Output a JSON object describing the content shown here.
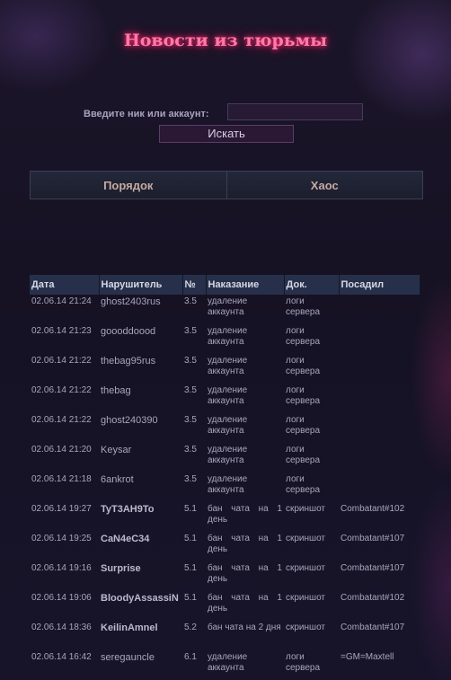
{
  "page": {
    "title": "Новости из тюрьмы"
  },
  "search": {
    "label": "Введите ник или аккаунт:",
    "value": "",
    "button_label": "Искать"
  },
  "tabs": [
    "Порядок",
    "Хаос"
  ],
  "table": {
    "headers": [
      "Дата",
      "Нарушитель",
      "№",
      "Наказание",
      "Док.",
      "Посадил"
    ],
    "rows": [
      {
        "date": "02.06.14 21:24",
        "offender": "ghost2403rus",
        "bold": false,
        "rule": "3.5",
        "punishment": "удаление аккаунта",
        "doc": "логи сервера",
        "jailer": ""
      },
      {
        "date": "02.06.14 21:23",
        "offender": "goooddoood",
        "bold": false,
        "rule": "3.5",
        "punishment": "удаление аккаунта",
        "doc": "логи сервера",
        "jailer": ""
      },
      {
        "date": "02.06.14 21:22",
        "offender": "thebag95rus",
        "bold": false,
        "rule": "3.5",
        "punishment": "удаление аккаунта",
        "doc": "логи сервера",
        "jailer": ""
      },
      {
        "date": "02.06.14 21:22",
        "offender": "thebag",
        "bold": false,
        "rule": "3.5",
        "punishment": "удаление аккаунта",
        "doc": "логи сервера",
        "jailer": ""
      },
      {
        "date": "02.06.14 21:22",
        "offender": "ghost240390",
        "bold": false,
        "rule": "3.5",
        "punishment": "удаление аккаунта",
        "doc": "логи сервера",
        "jailer": ""
      },
      {
        "date": "02.06.14 21:20",
        "offender": "Keysar",
        "bold": false,
        "rule": "3.5",
        "punishment": "удаление аккаунта",
        "doc": "логи сервера",
        "jailer": ""
      },
      {
        "date": "02.06.14 21:18",
        "offender": "6ankrot",
        "bold": false,
        "rule": "3.5",
        "punishment": "удаление аккаунта",
        "doc": "логи сервера",
        "jailer": ""
      },
      {
        "date": "02.06.14 19:27",
        "offender": "TyT3AH9To",
        "bold": true,
        "rule": "5.1",
        "punishment": "бан чата на 1 день",
        "doc": "скриншот",
        "jailer": "Combatant#102"
      },
      {
        "date": "02.06.14 19:25",
        "offender": "CaN4eC34",
        "bold": true,
        "rule": "5.1",
        "punishment": "бан чата на 1 день",
        "doc": "скриншот",
        "jailer": "Combatant#107"
      },
      {
        "date": "02.06.14 19:16",
        "offender": "Surprise",
        "bold": true,
        "rule": "5.1",
        "punishment": "бан чата на 1 день",
        "doc": "скриншот",
        "jailer": "Combatant#107"
      },
      {
        "date": "02.06.14 19:06",
        "offender": "BloodyAssassiN",
        "bold": true,
        "rule": "5.1",
        "punishment": "бан чата на 1 день",
        "doc": "скриншот",
        "jailer": "Combatant#102"
      },
      {
        "date": "02.06.14 18:36",
        "offender": "KeilinAmnel",
        "bold": true,
        "rule": "5.2",
        "punishment": "бан чата на 2 дня",
        "doc": "скриншот",
        "jailer": "Combatant#107"
      },
      {
        "date": "02.06.14 16:42",
        "offender": "seregauncle",
        "bold": false,
        "rule": "6.1",
        "punishment": "удаление аккаунта",
        "doc": "логи сервера",
        "jailer": "=GM=Maxtell"
      }
    ]
  }
}
